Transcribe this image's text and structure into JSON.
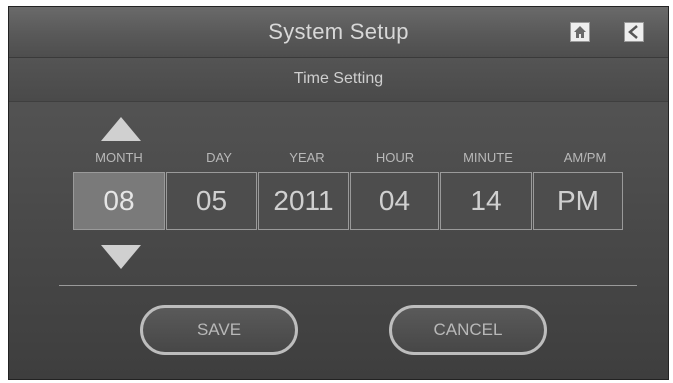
{
  "header": {
    "title": "System Setup",
    "icons": [
      "home-icon",
      "back-icon"
    ]
  },
  "subheader": {
    "title": "Time Setting"
  },
  "fields": [
    {
      "label": "MONTH",
      "value": "08",
      "selected": true
    },
    {
      "label": "DAY",
      "value": "05",
      "selected": false
    },
    {
      "label": "YEAR",
      "value": "2011",
      "selected": false
    },
    {
      "label": "HOUR",
      "value": "04",
      "selected": false
    },
    {
      "label": "MINUTE",
      "value": "14",
      "selected": false
    },
    {
      "label": "AM/PM",
      "value": "PM",
      "selected": false
    }
  ],
  "buttons": {
    "save_label": "SAVE",
    "cancel_label": "CANCEL"
  },
  "icons": {
    "up": "up-arrow-icon",
    "down": "down-arrow-icon"
  }
}
